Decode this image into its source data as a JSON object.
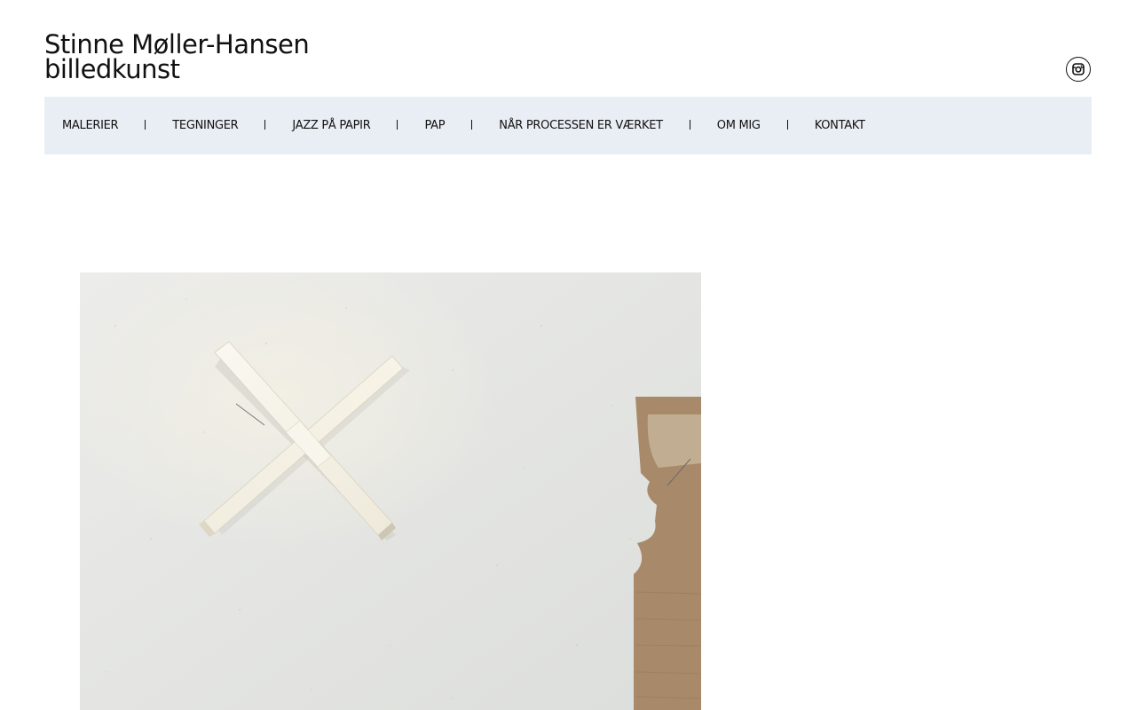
{
  "site": {
    "title_line1": "Stinne Møller-Hansen",
    "title_line2": "billedkunst"
  },
  "social": {
    "icon": "instagram-icon"
  },
  "nav": {
    "items": [
      {
        "label": "MALERIER"
      },
      {
        "label": "TEGNINGER"
      },
      {
        "label": "JAZZ PÅ PAPIR"
      },
      {
        "label": "PAP"
      },
      {
        "label": "NÅR PROCESSEN ER VÆRKET"
      },
      {
        "label": "OM MIG"
      },
      {
        "label": "KONTAKT"
      }
    ]
  },
  "colors": {
    "nav_background": "#e9eef5",
    "text": "#111111",
    "background": "#ffffff"
  }
}
